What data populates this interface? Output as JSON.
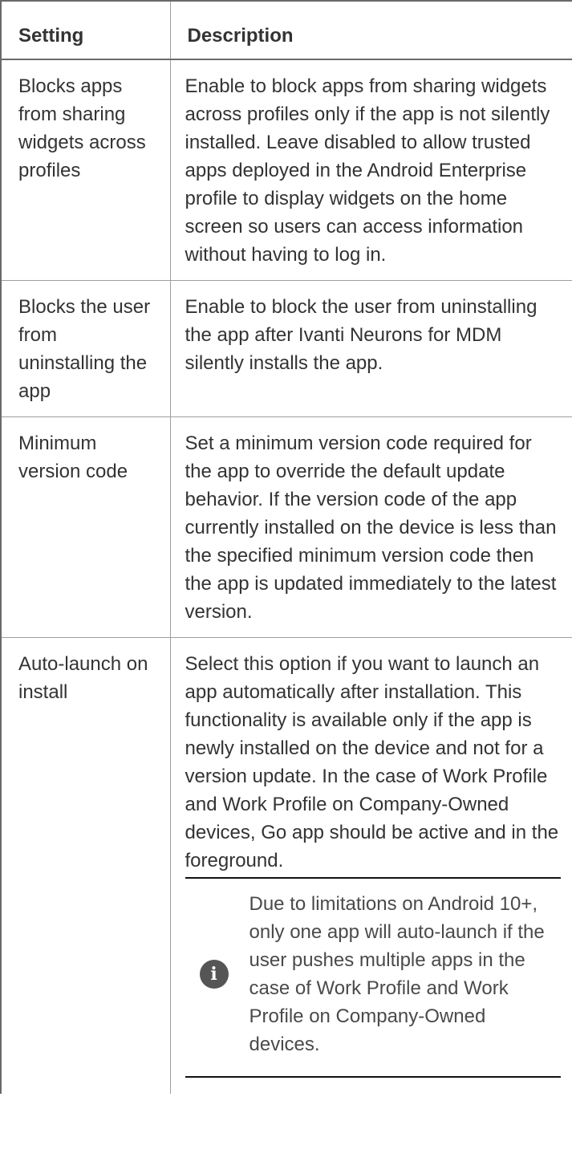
{
  "table": {
    "headers": {
      "setting": "Setting",
      "description": "Description"
    },
    "rows": [
      {
        "setting": "Blocks apps from sharing widgets across profiles",
        "description": "Enable to block apps from sharing widgets across profiles only if the app is not silently installed. Leave disabled to allow trusted apps deployed in the Android Enterprise profile to display widgets on the home screen so users can access information without having to log in."
      },
      {
        "setting": "Blocks the user from uninstalling the app",
        "description": "Enable to block the user from uninstalling the app after Ivanti Neurons for MDM silently installs the app."
      },
      {
        "setting": "Minimum version code",
        "description": "Set a minimum version code required for the app to override the default update behavior. If the version code of the app currently installed on the device is less than the specified minimum version code then the app is updated immediately to the latest version."
      },
      {
        "setting": "Auto-launch on install",
        "description": "Select this option if you want to launch an app automatically after installation. This functionality is available only if the app is newly installed on the device and not for a version update. In the case of Work Profile and Work Profile on Company-Owned devices, Go app should be active and in the foreground.",
        "note": {
          "icon": "info-icon",
          "icon_glyph": "i",
          "text": "Due to limitations on Android 10+, only one app will auto-launch if the user pushes multiple apps in the case of Work Profile and Work Profile on Company-Owned devices."
        }
      }
    ]
  }
}
